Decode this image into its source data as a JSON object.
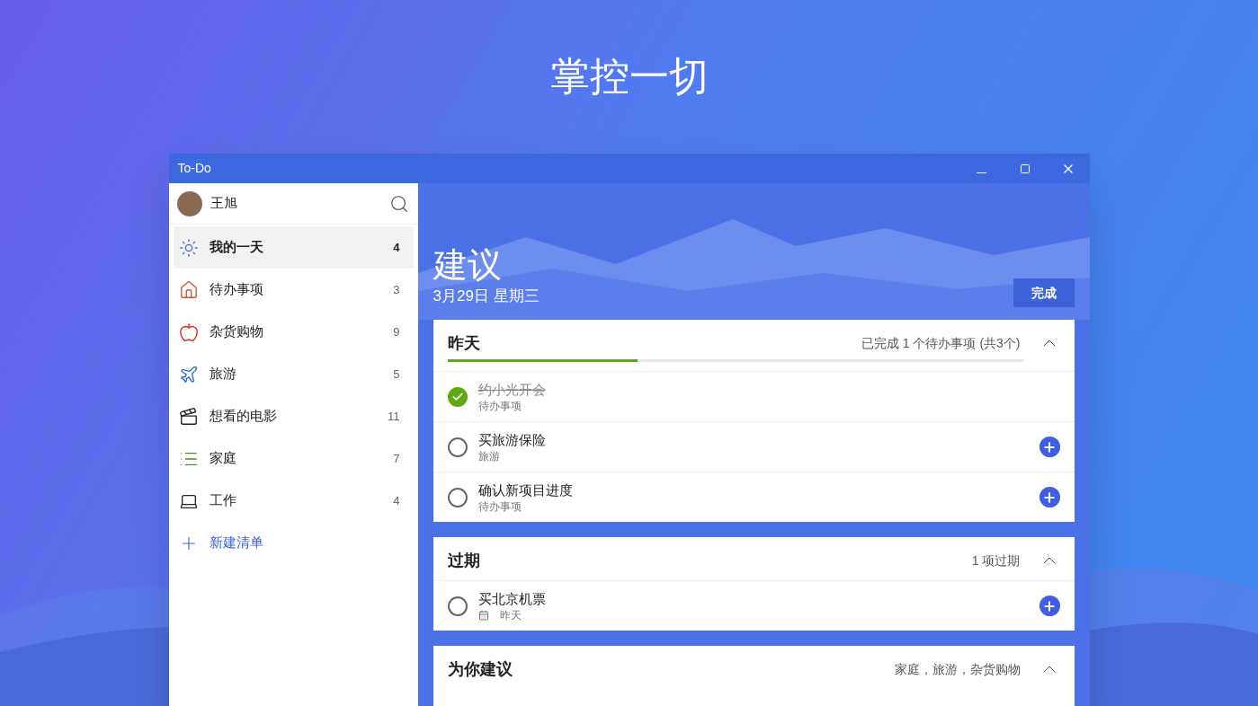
{
  "headline": "掌控一切",
  "window": {
    "title": "To-Do"
  },
  "sidebar": {
    "user": {
      "name": "王旭"
    },
    "items": [
      {
        "label": "我的一天",
        "count": "4",
        "selected": true
      },
      {
        "label": "待办事项",
        "count": "3",
        "selected": false
      },
      {
        "label": "杂货购物",
        "count": "9",
        "selected": false
      },
      {
        "label": "旅游",
        "count": "5",
        "selected": false
      },
      {
        "label": "想看的电影",
        "count": "11",
        "selected": false
      },
      {
        "label": "家庭",
        "count": "7",
        "selected": false
      },
      {
        "label": "工作",
        "count": "4",
        "selected": false
      }
    ],
    "new_list": "新建清单"
  },
  "main": {
    "title": "建议",
    "date": "3月29日 星期三",
    "done_button": "完成",
    "sections": [
      {
        "title": "昨天",
        "summary": "已完成 1 个待办事项 (共3个)",
        "expanded": true,
        "progress": {
          "level": 0.33
        },
        "tasks": [
          {
            "kind": "list",
            "title": "约小光开会",
            "subtitle": "待办事项",
            "completed": true
          },
          {
            "kind": "list",
            "title": "买旅游保险",
            "subtitle": "旅游",
            "completed": false
          },
          {
            "kind": "list",
            "title": "确认新项目进度",
            "subtitle": "待办事项",
            "completed": false
          }
        ]
      },
      {
        "title": "过期",
        "summary": "1 项过期",
        "expanded": true,
        "tasks": [
          {
            "kind": "due",
            "title": "买北京机票",
            "subtitle": "昨天",
            "completed": false
          }
        ]
      },
      {
        "title": "为你建议",
        "summary": "家庭，旅游，杂货购物",
        "expanded": true
      }
    ]
  }
}
